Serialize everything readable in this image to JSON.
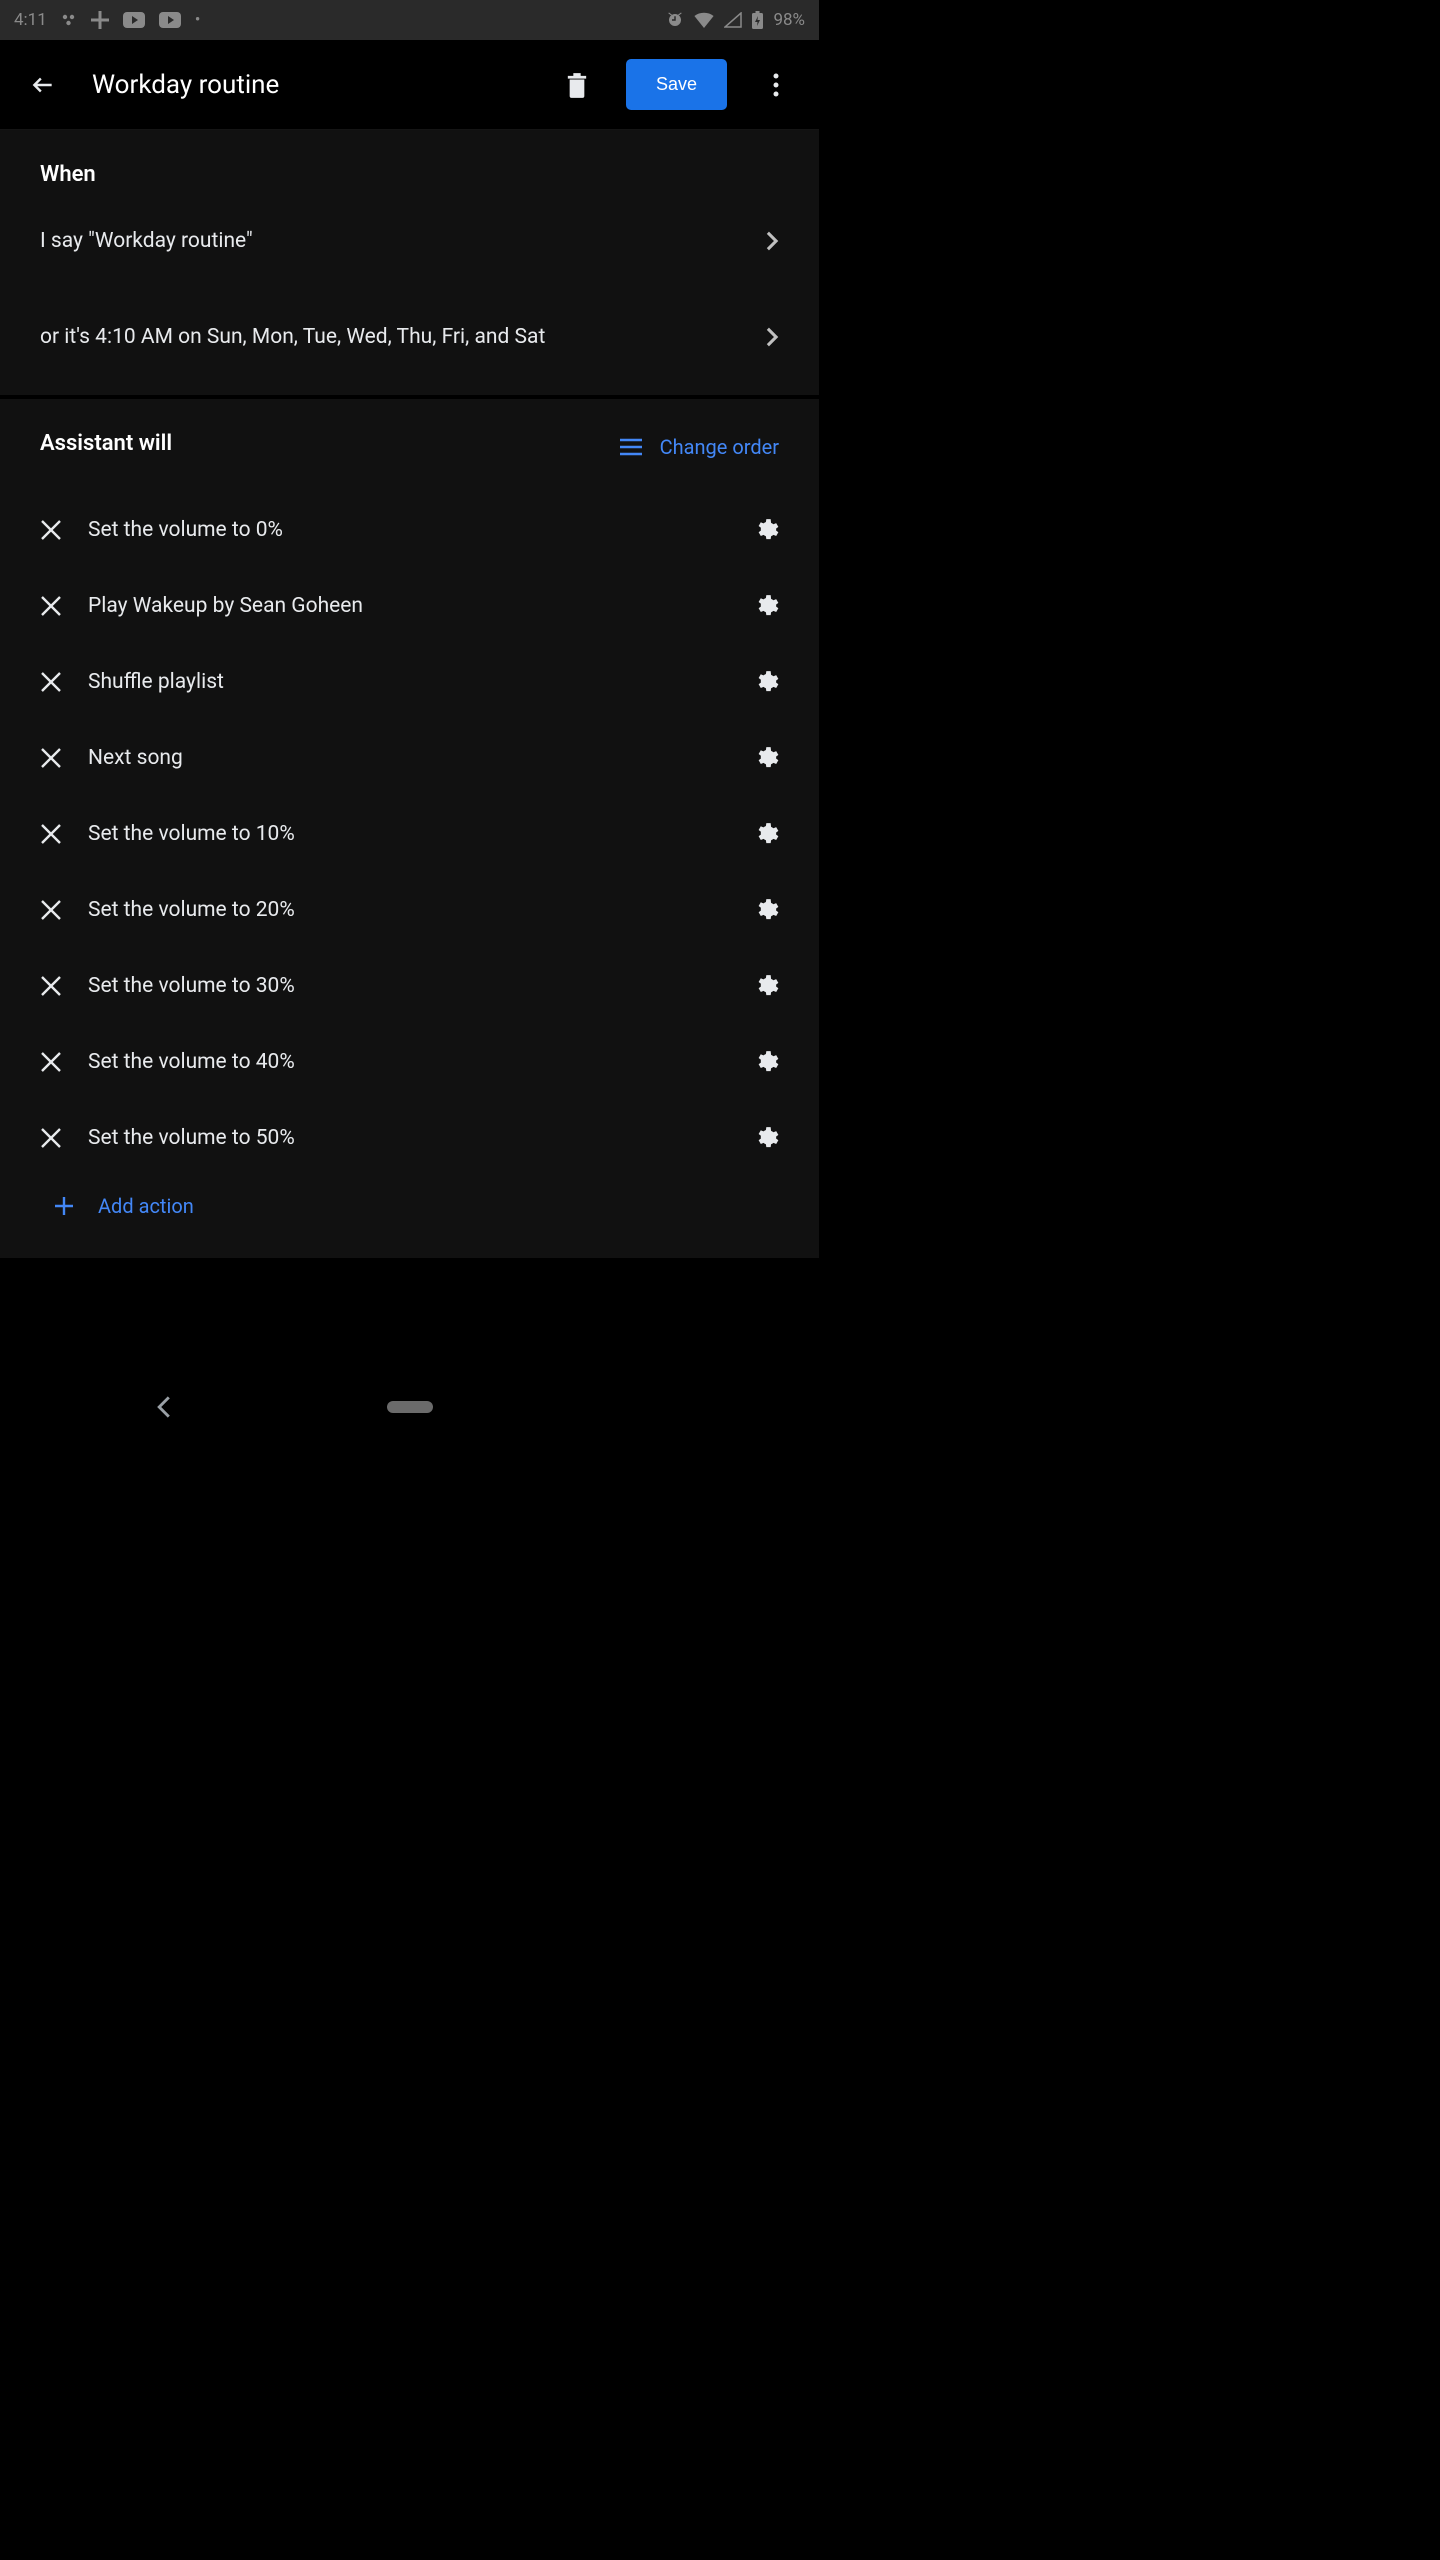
{
  "status": {
    "time": "4:11",
    "battery": "98%"
  },
  "appbar": {
    "title": "Workday routine",
    "save": "Save"
  },
  "when": {
    "header": "When",
    "triggers": [
      "I say \"Workday routine\"",
      "or it's 4:10 AM on Sun, Mon, Tue, Wed, Thu, Fri, and Sat"
    ]
  },
  "assistant": {
    "header": "Assistant will",
    "change_order": "Change order",
    "actions": [
      "Set the volume to 0%",
      "Play Wakeup by Sean Goheen",
      "Shuffle playlist",
      "Next song",
      "Set the volume to 10%",
      "Set the volume to 20%",
      "Set the volume to 30%",
      "Set the volume to 40%",
      "Set the volume to 50%"
    ],
    "add_action": "Add action"
  }
}
